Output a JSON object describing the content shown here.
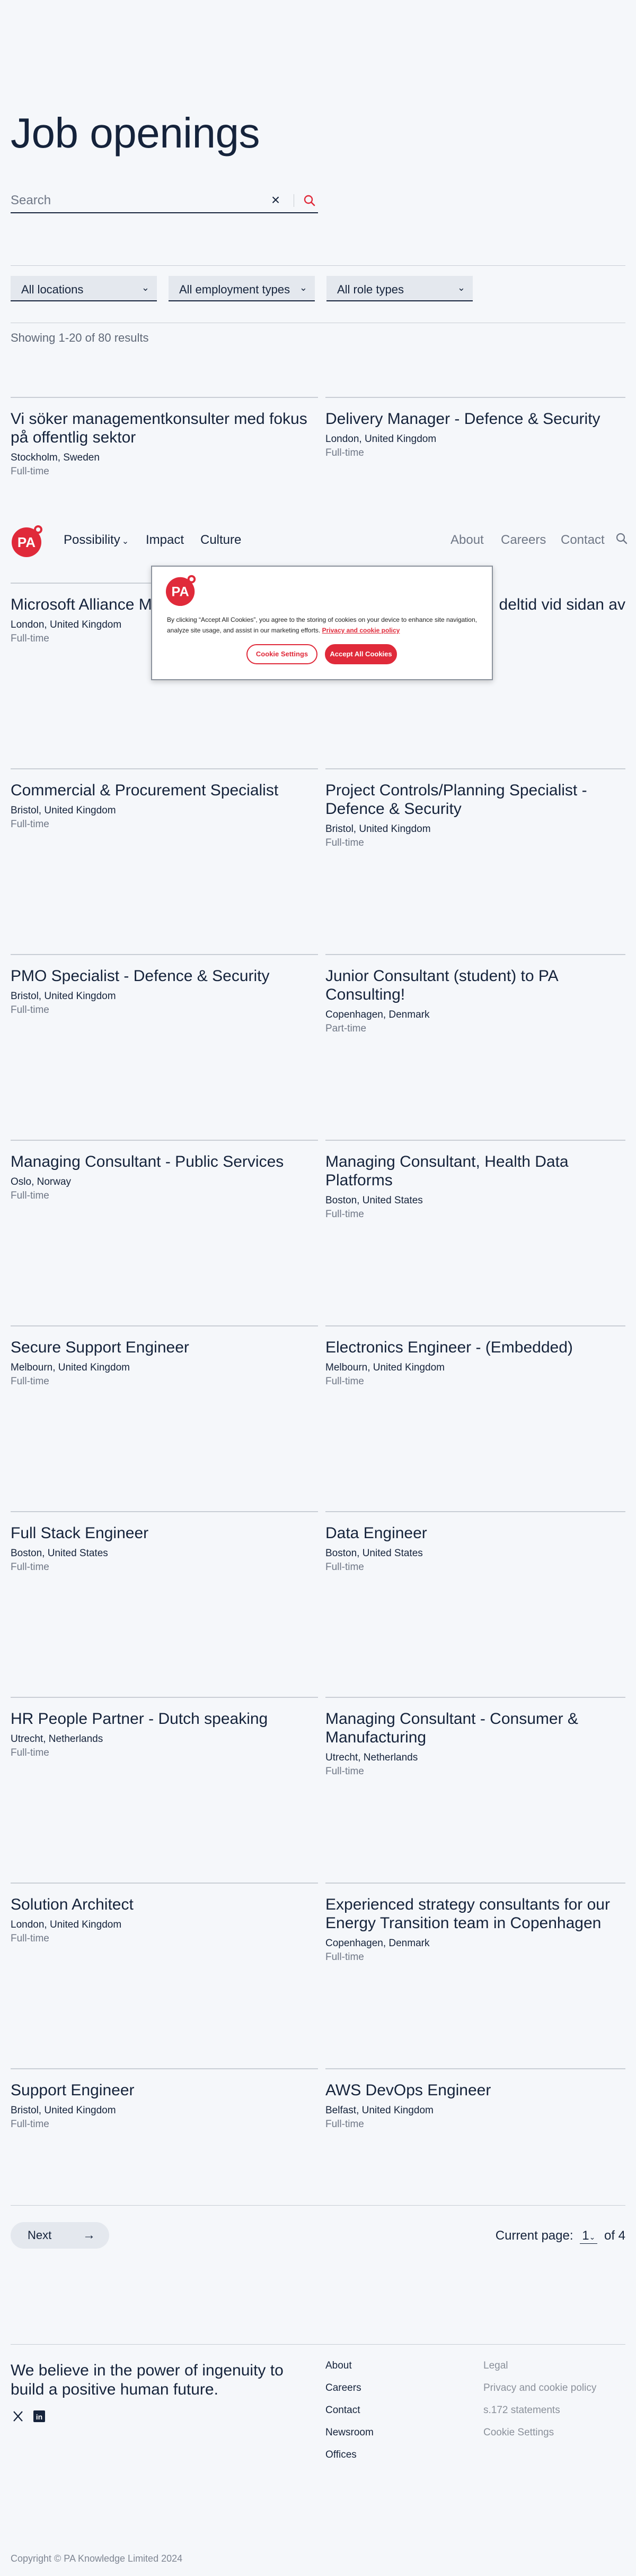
{
  "page": {
    "title": "Job openings",
    "results_text": "Showing 1-20 of 80 results"
  },
  "search": {
    "placeholder": "Search",
    "clear_icon": "close-icon",
    "submit_icon": "search-icon"
  },
  "filters": [
    {
      "label": "All locations"
    },
    {
      "label": "All employment types"
    },
    {
      "label": "All role types"
    }
  ],
  "nav": {
    "left": [
      "Possibility",
      "Impact",
      "Culture"
    ],
    "right": [
      "About",
      "Careers",
      "Contact"
    ],
    "logo_text": "PA"
  },
  "cookie": {
    "text": "By clicking “Accept All Cookies”, you agree to the storing of cookies on your device to enhance site navigation, analyze site usage, and assist in our marketing efforts.",
    "policy_link": "Privacy and cookie policy",
    "settings_label": "Cookie Settings",
    "accept_label": "Accept All Cookies"
  },
  "jobs": [
    {
      "title": "Vi söker managementkonsulter med fokus på offentlig sektor",
      "location": "Stockholm, Sweden",
      "type": "Full-time"
    },
    {
      "title": "Delivery Manager - Defence & Security",
      "location": "London, United Kingdom",
      "type": "Full-time"
    },
    {
      "title": "Microsoft Alliance M",
      "location": "London, United Kingdom",
      "type": "Full-time"
    },
    {
      "title": "deltid vid sidan av",
      "location": "",
      "type": ""
    },
    {
      "title": "Commercial & Procurement Specialist",
      "location": "Bristol, United Kingdom",
      "type": "Full-time"
    },
    {
      "title": "Project Controls/Planning Specialist - Defence & Security",
      "location": "Bristol, United Kingdom",
      "type": "Full-time"
    },
    {
      "title": "PMO Specialist - Defence & Security",
      "location": "Bristol, United Kingdom",
      "type": "Full-time"
    },
    {
      "title": "Junior Consultant (student) to PA Consulting!",
      "location": "Copenhagen, Denmark",
      "type": "Part-time"
    },
    {
      "title": "Managing Consultant - Public Services",
      "location": "Oslo, Norway",
      "type": "Full-time"
    },
    {
      "title": "Managing Consultant, Health Data Platforms",
      "location": "Boston, United States",
      "type": "Full-time"
    },
    {
      "title": "Secure Support Engineer",
      "location": "Melbourn, United Kingdom",
      "type": "Full-time"
    },
    {
      "title": "Electronics Engineer - (Embedded)",
      "location": "Melbourn, United Kingdom",
      "type": "Full-time"
    },
    {
      "title": "Full Stack Engineer",
      "location": "Boston, United States",
      "type": "Full-time"
    },
    {
      "title": "Data Engineer",
      "location": "Boston, United States",
      "type": "Full-time"
    },
    {
      "title": "HR People Partner - Dutch speaking",
      "location": "Utrecht, Netherlands",
      "type": "Full-time"
    },
    {
      "title": "Managing Consultant - Consumer & Manufacturing",
      "location": "Utrecht, Netherlands",
      "type": "Full-time"
    },
    {
      "title": "Solution Architect",
      "location": "London, United Kingdom",
      "type": "Full-time"
    },
    {
      "title": "Experienced strategy consultants for our Energy Transition team in Copenhagen",
      "location": "Copenhagen, Denmark",
      "type": "Full-time"
    },
    {
      "title": "Support Engineer",
      "location": "Bristol, United Kingdom",
      "type": "Full-time"
    },
    {
      "title": "AWS DevOps Engineer",
      "location": "Belfast, United Kingdom",
      "type": "Full-time"
    }
  ],
  "pager": {
    "next_label": "Next",
    "current_label": "Current page:",
    "current_page": "1",
    "total": "of 4"
  },
  "footer": {
    "tagline": "We believe in the power of ingenuity to build a positive human future.",
    "links_main": [
      "About",
      "Careers",
      "Contact",
      "Newsroom",
      "Offices"
    ],
    "links_legal": [
      "Legal",
      "Privacy and cookie policy",
      "s.172 statements",
      "Cookie Settings"
    ],
    "social": [
      "x-icon",
      "linkedin-icon"
    ],
    "copyright": "Copyright © PA Knowledge Limited 2024"
  },
  "colors": {
    "brand": "#e02a3a",
    "navy": "#15233b",
    "background": "#f5f7fa"
  }
}
